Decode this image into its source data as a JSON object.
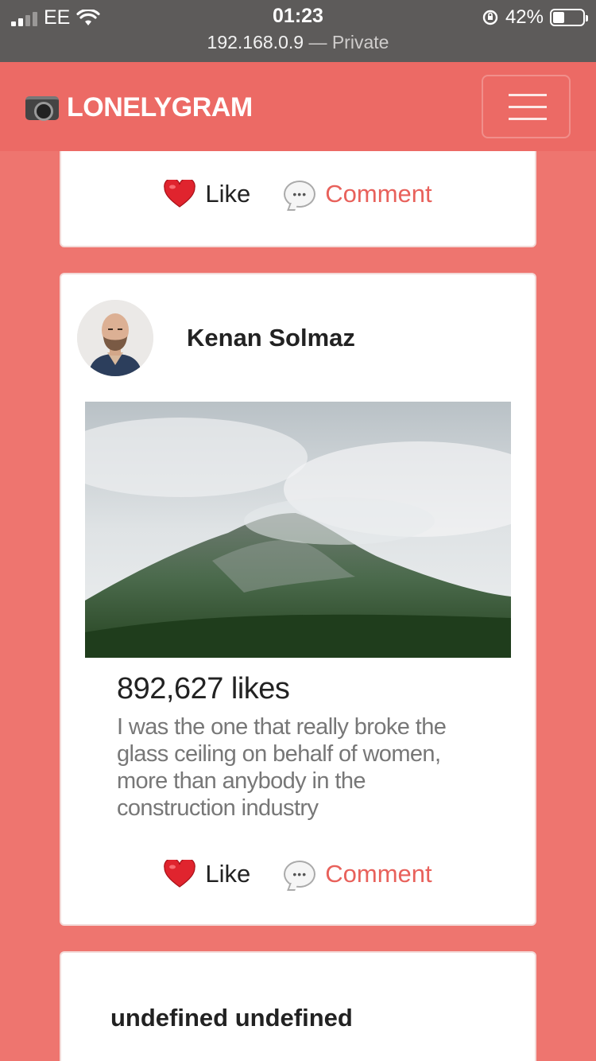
{
  "status_bar": {
    "carrier": "EE",
    "time": "01:23",
    "url": "192.168.0.9",
    "url_suffix": "— Private",
    "battery": "42%",
    "battery_level": 0.42
  },
  "navbar": {
    "brand": "LONELYGRAM",
    "menu_icon": "hamburger-icon"
  },
  "actions": {
    "like": "Like",
    "comment": "Comment"
  },
  "posts": [
    {
      "username": "Kenan Solmaz",
      "likes": "892,627 likes",
      "caption": "I was the one that really broke the glass ceiling on behalf of women, more than anybody in the construction industry"
    },
    {
      "username": "undefined undefined"
    }
  ],
  "colors": {
    "background": "#ee756f",
    "navbar": "#ec6a65",
    "accent": "#e8615b",
    "status_bar": "#5d5b5a"
  }
}
